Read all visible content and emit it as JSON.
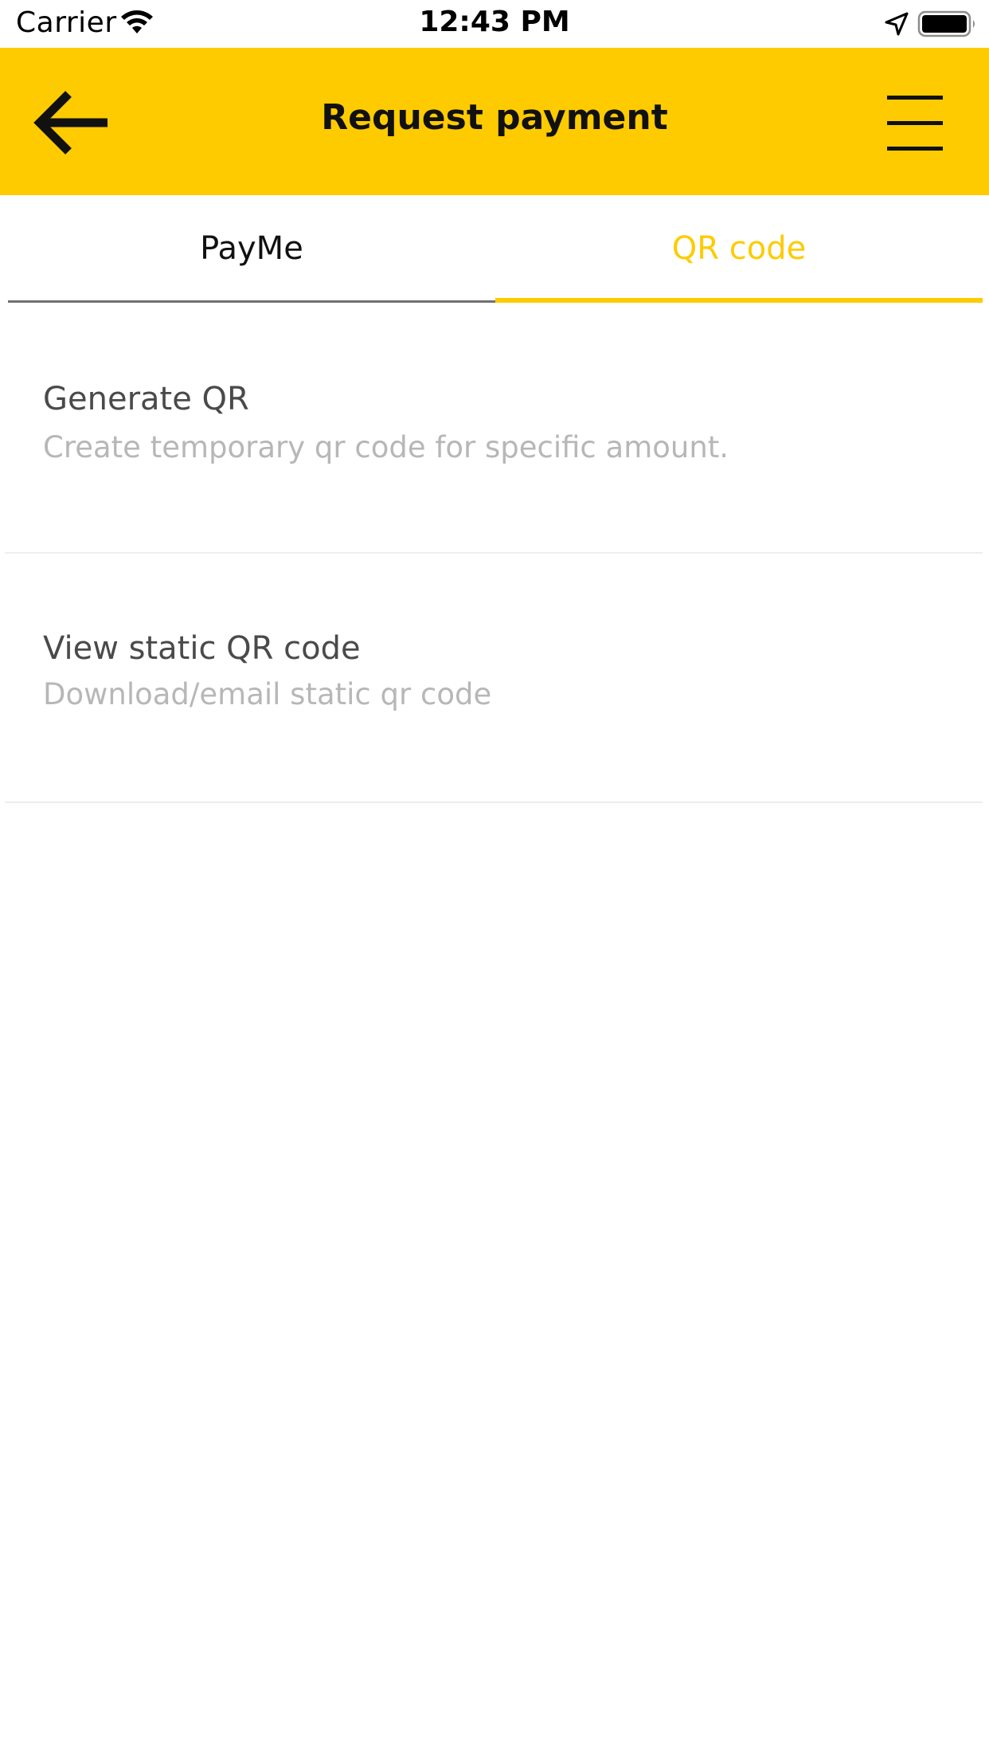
{
  "status_bar": {
    "carrier": "Carrier",
    "time": "12:43 PM",
    "icons": [
      "wifi-icon",
      "location-arrow-icon",
      "battery-icon"
    ]
  },
  "header": {
    "title": "Request payment",
    "back_icon": "arrow-left-icon",
    "menu_icon": "hamburger-menu-icon"
  },
  "tabs": [
    {
      "label": "PayMe",
      "active": false
    },
    {
      "label": "QR code",
      "active": true
    }
  ],
  "list": [
    {
      "title": "Generate QR",
      "subtitle": "Create temporary qr code for specific amount."
    },
    {
      "title": "View static QR code",
      "subtitle": "Download/email static qr code"
    }
  ],
  "colors": {
    "accent": "#fecb00",
    "title_text": "#4a4a4a",
    "subtitle_text": "#b7b7b7",
    "inactive_tab_line": "#707070",
    "divider": "#eeeeee"
  }
}
